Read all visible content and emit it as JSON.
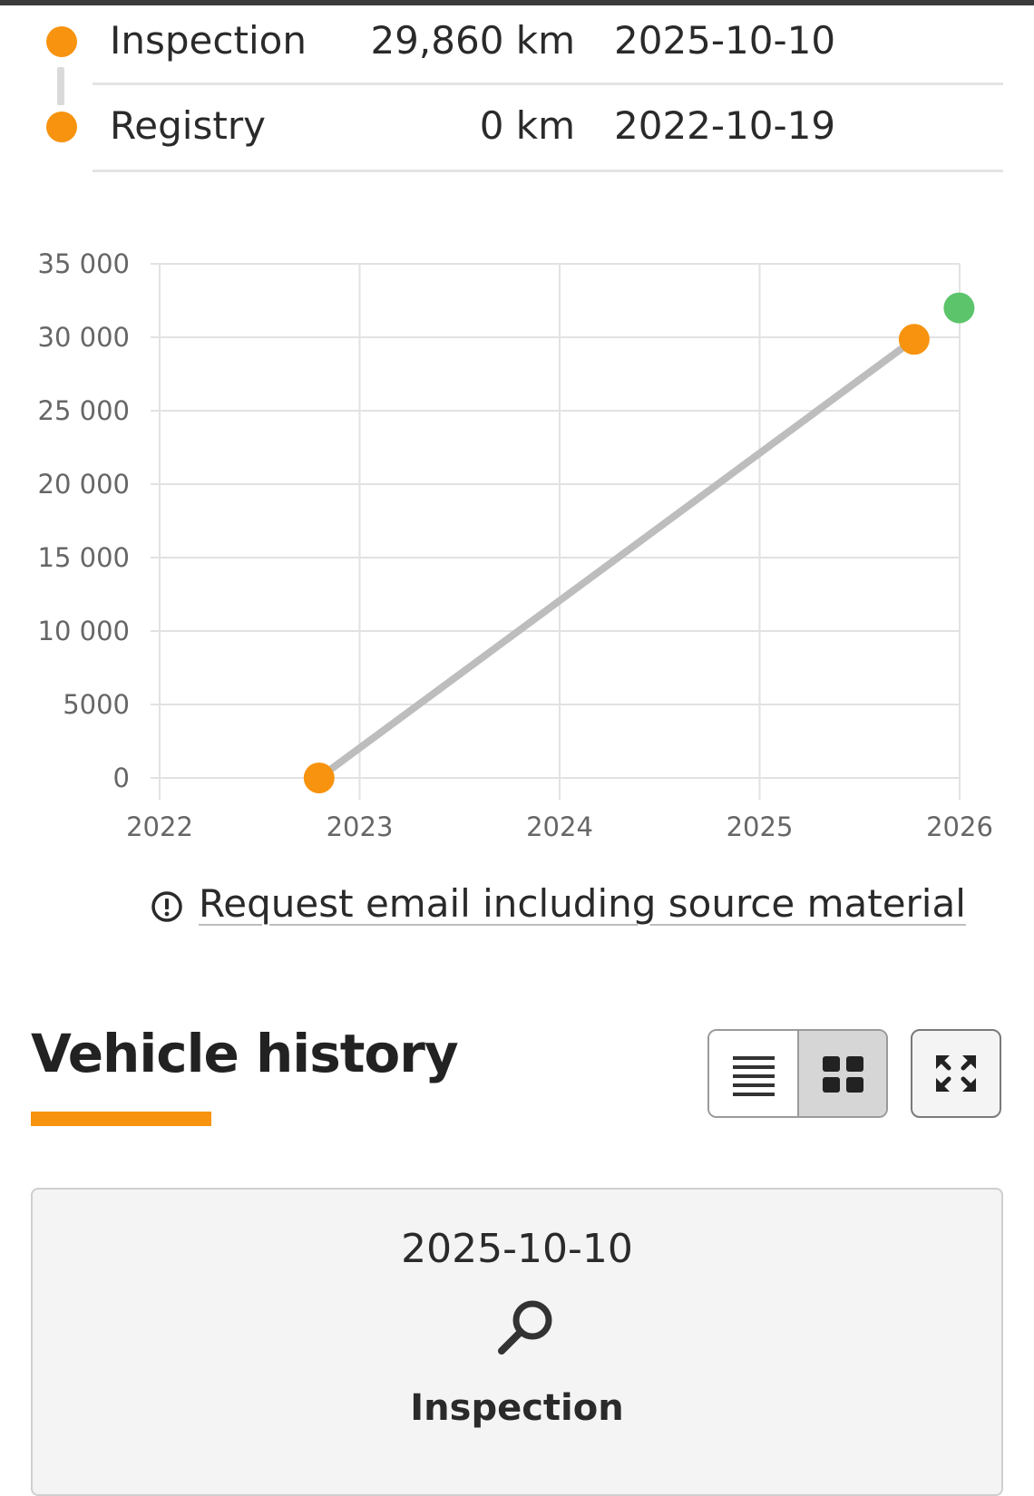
{
  "timeline": [
    {
      "label": "Inspection",
      "mileage": "29,860 km",
      "date": "2025-10-10",
      "dot_color": "#f7930f"
    },
    {
      "label": "Registry",
      "mileage": "0 km",
      "date": "2022-10-19",
      "dot_color": "#f7930f"
    }
  ],
  "chart_data": {
    "type": "line",
    "title": "",
    "xlabel": "",
    "ylabel": "",
    "x_ticks": [
      "2022",
      "2023",
      "2024",
      "2025",
      "2026"
    ],
    "y_ticks": [
      "0",
      "5000",
      "10 000",
      "15 000",
      "20 000",
      "25 000",
      "30 000",
      "35 000"
    ],
    "xlim": [
      2022,
      2026
    ],
    "ylim": [
      0,
      35000
    ],
    "grid": true,
    "series": [
      {
        "values": [
          {
            "x": "2022-10-19",
            "y": 0,
            "color": "#f7930f"
          },
          {
            "x": "2025-10-10",
            "y": 29860,
            "color": "#f7930f"
          }
        ],
        "line_color": "#bdbdbd"
      }
    ],
    "extra_points": [
      {
        "x": "2025-12-31",
        "y": 32000,
        "color": "#5cc46a"
      }
    ]
  },
  "request": {
    "link_text": "Request email including source material",
    "icon": "alert-circle-icon"
  },
  "history": {
    "title": "Vehicle history",
    "accent_color": "#f7930f",
    "view_list_icon": "list-view-icon",
    "view_grid_icon": "grid-view-icon",
    "expand_icon": "expand-icon",
    "selected_view": "grid"
  },
  "cards": [
    {
      "date": "2025-10-10",
      "icon": "search-icon",
      "type": "Inspection"
    }
  ]
}
